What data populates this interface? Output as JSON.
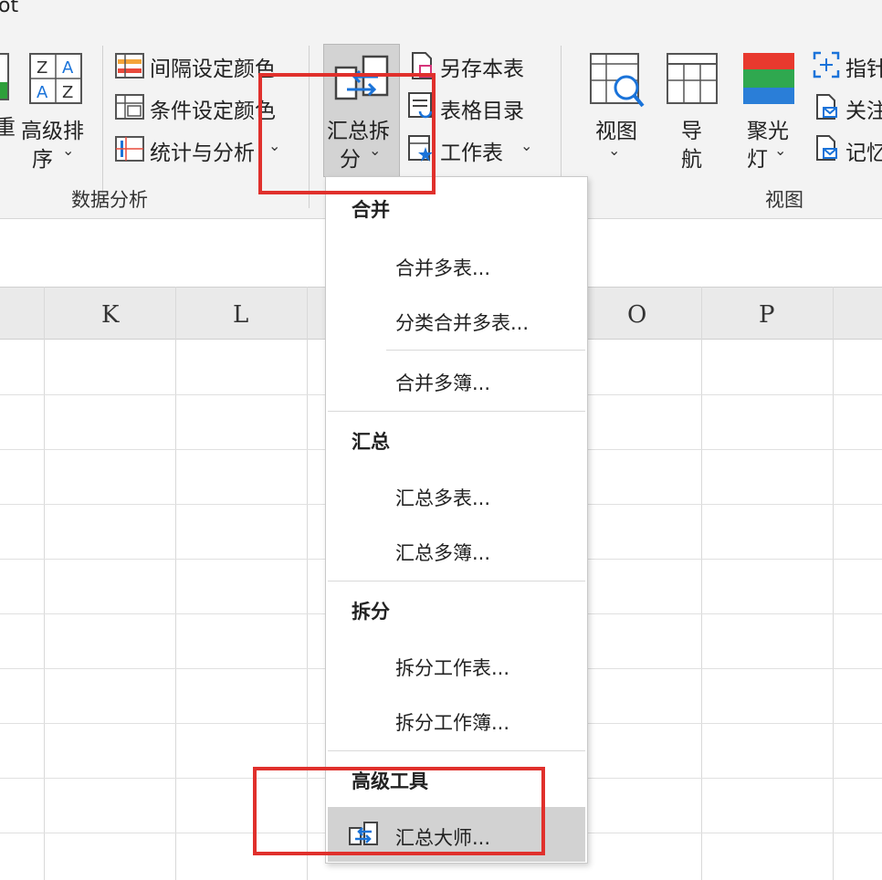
{
  "ribbon": {
    "cut_top_text": "ot",
    "cut_left_char": "重",
    "sort": {
      "line1": "高级排",
      "line2": "序",
      "chev": "⌄"
    },
    "color_interval": "间隔设定颜色",
    "color_condition": "条件设定颜色",
    "stats_analysis": "统计与分析",
    "stats_chev": "⌄",
    "group_data_analysis": "数据分析",
    "summary_split": {
      "line1": "汇总拆",
      "line2": "分",
      "chev": "⌄"
    },
    "save_table": "另存本表",
    "table_toc": "表格目录",
    "worksheet": "工作表",
    "worksheet_chev": "⌄",
    "view": {
      "label": "视图",
      "chev": "⌄"
    },
    "nav": {
      "line1": "导",
      "line2": "航"
    },
    "spotlight": {
      "line1": "聚光",
      "line2": "灯",
      "chev": "⌄"
    },
    "pointer": "指针",
    "follow": "关注",
    "memo": "记忆",
    "group_view": "视图"
  },
  "columns": [
    "K",
    "L",
    "O",
    "P"
  ],
  "menu": {
    "section_merge": "合并",
    "merge_sheets": "合并多表...",
    "category_merge": "分类合并多表...",
    "merge_books": "合并多簿...",
    "section_summary": "汇总",
    "summary_sheets": "汇总多表...",
    "summary_books": "汇总多簿...",
    "section_split": "拆分",
    "split_sheet": "拆分工作表...",
    "split_book": "拆分工作簿...",
    "section_advanced": "高级工具",
    "summary_master": "汇总大师..."
  },
  "colors": {
    "highlight_box": "#e0302c",
    "ribbon_bg": "#f3f3f3",
    "menu_hover": "#d2d2d2"
  }
}
